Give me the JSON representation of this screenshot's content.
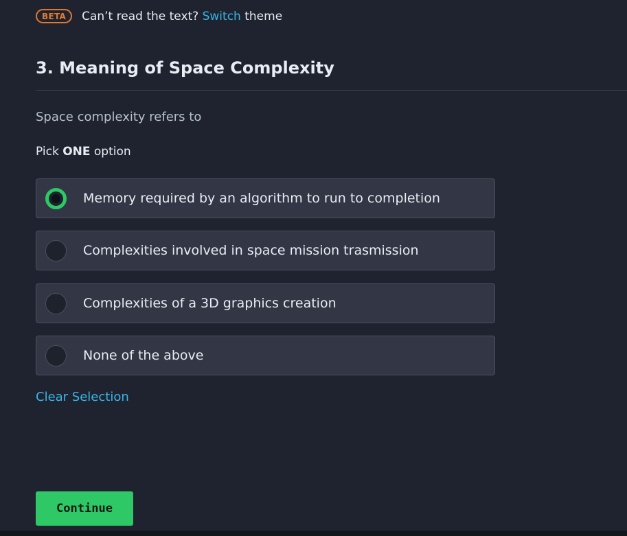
{
  "beta_bar": {
    "badge": "BETA",
    "text_prefix": "Can’t read the text?",
    "link": "Switch",
    "text_suffix": "theme"
  },
  "question": {
    "title": "3. Meaning of Space Complexity",
    "prompt": "Space complexity refers to",
    "pick_prefix": "Pick",
    "pick_emphasis": "ONE",
    "pick_suffix": "option",
    "options": [
      {
        "label": "Memory required by an algorithm to run to completion",
        "selected": true
      },
      {
        "label": "Complexities involved in space mission trasmission",
        "selected": false
      },
      {
        "label": "Complexities of a 3D graphics creation",
        "selected": false
      },
      {
        "label": "None of the above",
        "selected": false
      }
    ],
    "clear_label": "Clear Selection"
  },
  "footer": {
    "continue_label": "Continue"
  },
  "colors": {
    "background": "#1f2330",
    "accent_green": "#2ec866",
    "link_blue": "#39b6e6",
    "beta_orange": "#e07a2f"
  }
}
